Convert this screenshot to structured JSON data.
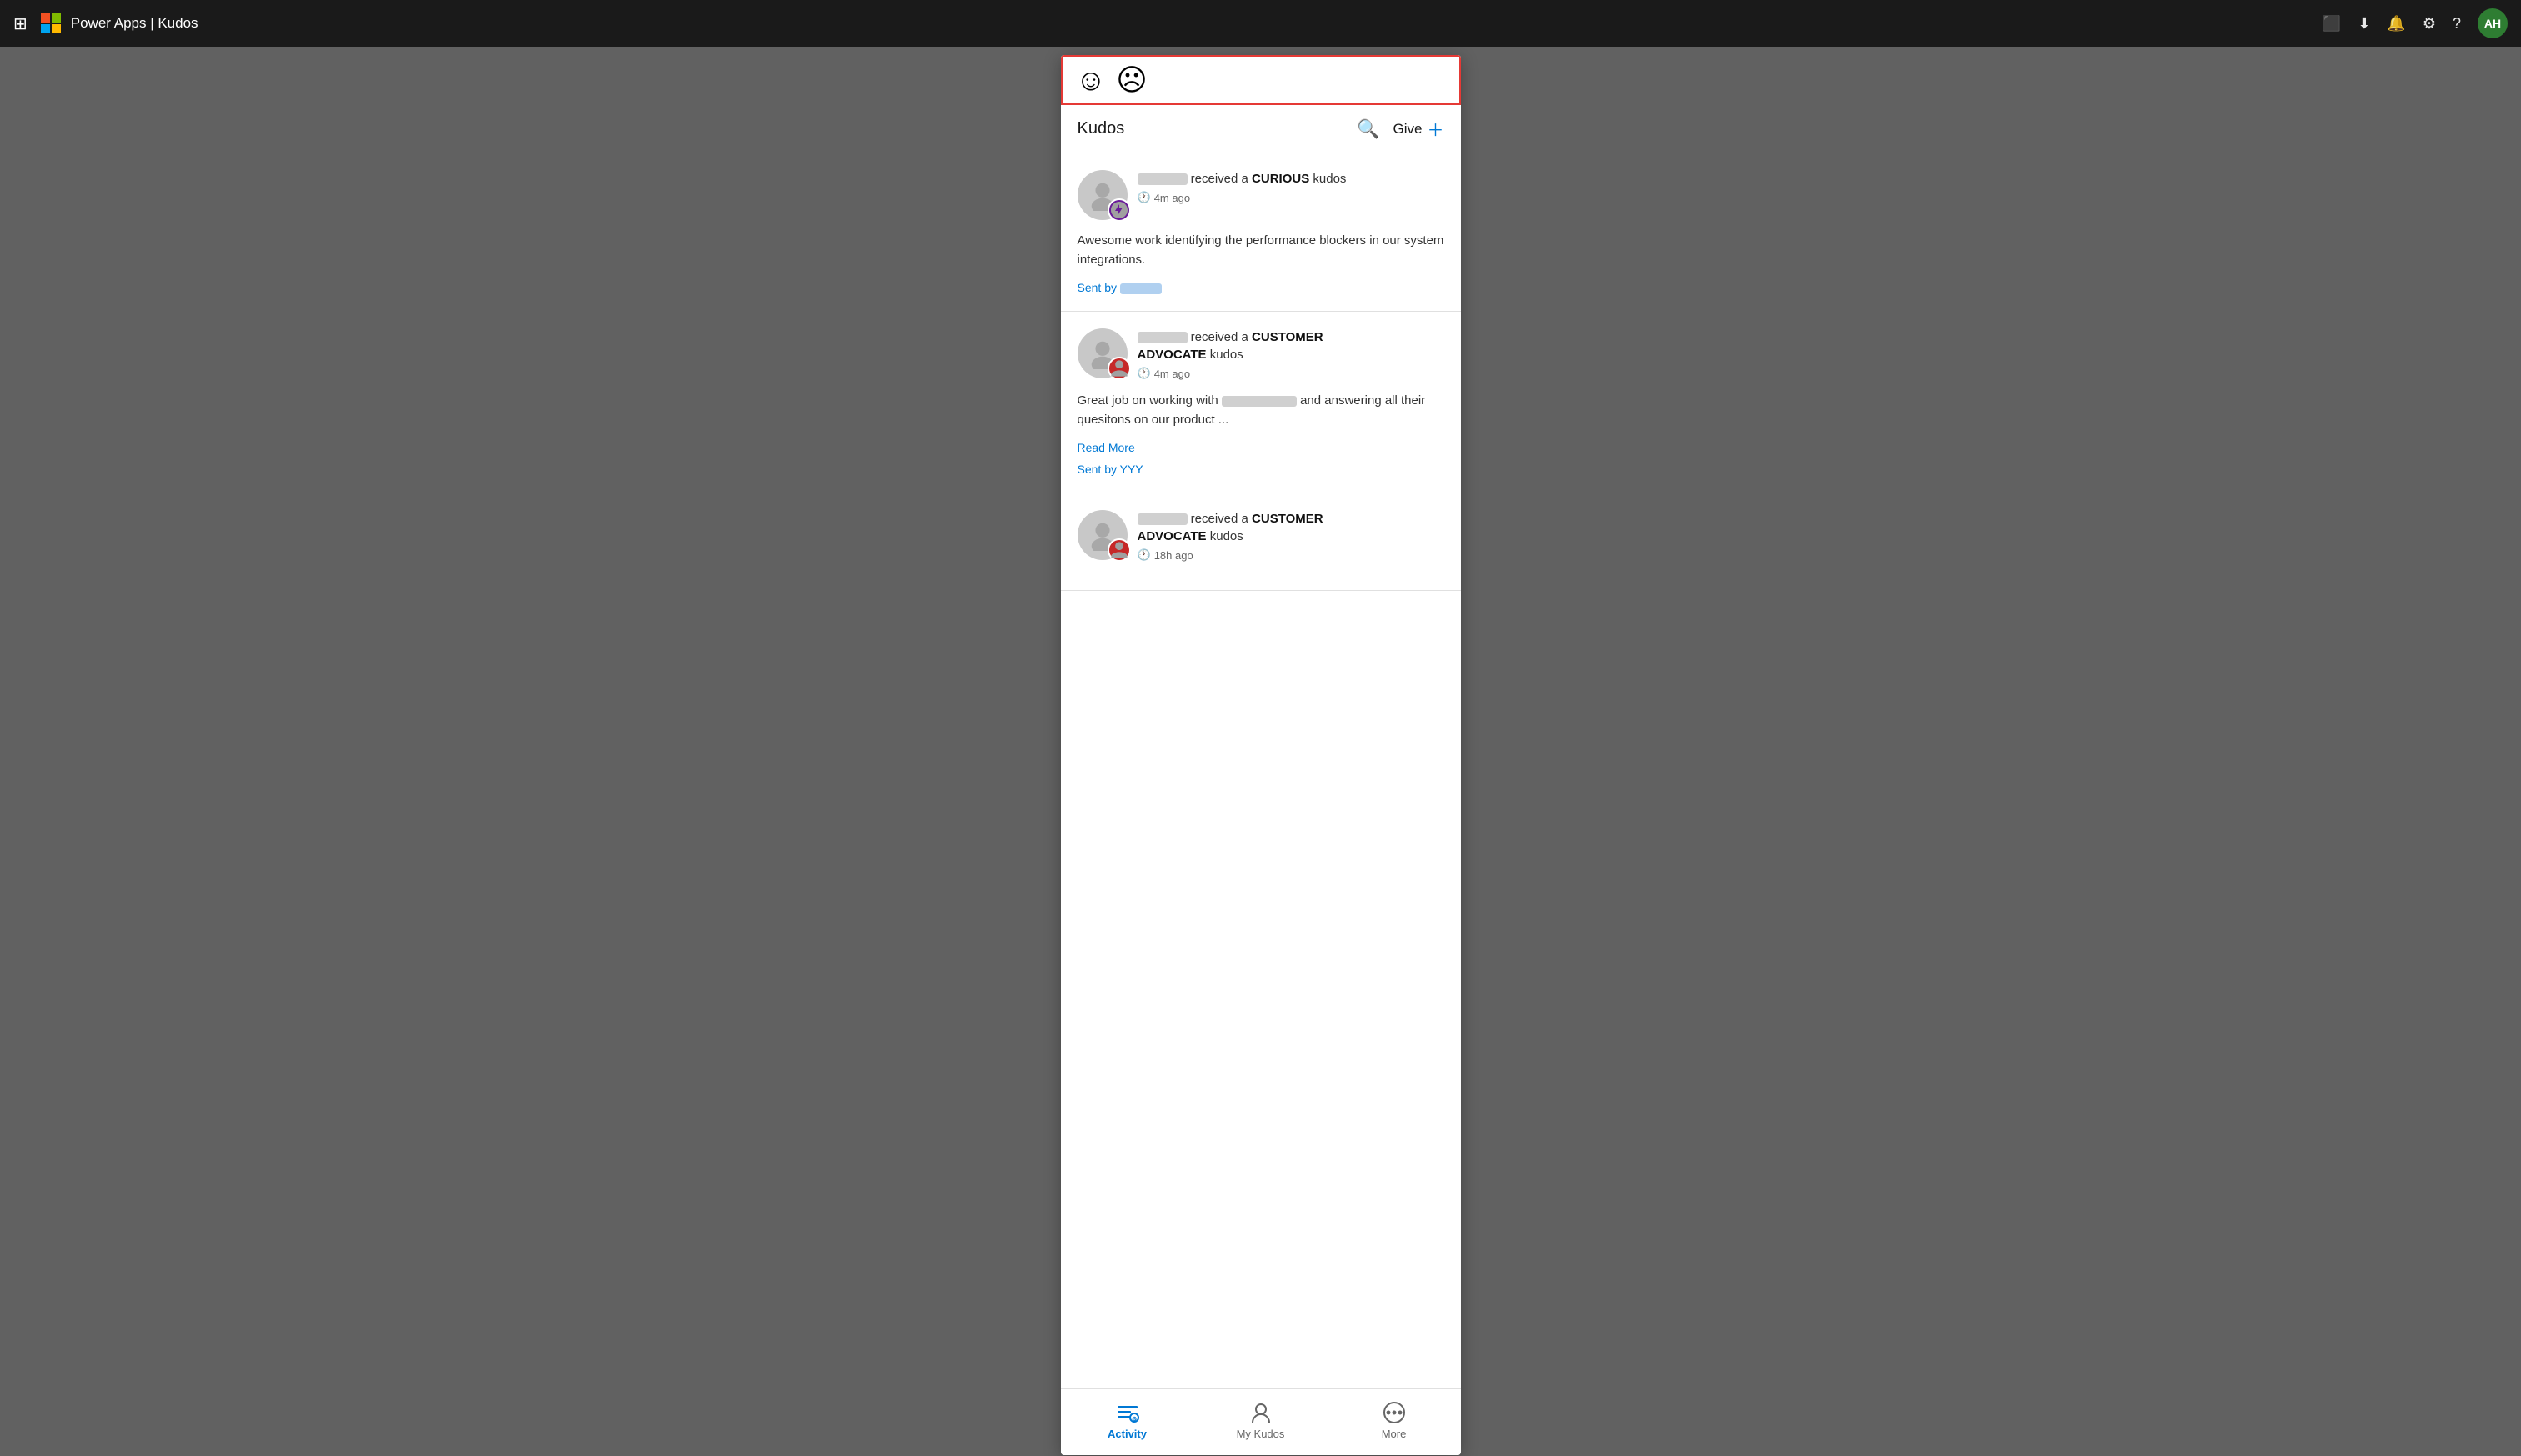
{
  "nav": {
    "waffle_label": "⊞",
    "brand": "Microsoft",
    "app_name": "Power Apps | Kudos",
    "icons": {
      "screen_share": "⬛",
      "download": "⬇",
      "bell": "🔔",
      "settings": "⚙",
      "help": "?"
    },
    "avatar": "AH"
  },
  "panel": {
    "emoji_selector": {
      "happy_emoji": "☺",
      "sad_emoji": "☹"
    },
    "header": {
      "title": "Kudos",
      "give_label": "Give"
    },
    "feed": {
      "cards": [
        {
          "id": 1,
          "recipient_blurred": true,
          "action": "received a",
          "kudos_type": "CURIOUS",
          "kudos_suffix": "kudos",
          "time": "4m ago",
          "badge_type": "curious",
          "body": "Awesome work identifying the performance blockers in our system integrations.",
          "sent_by_label": "Sent by",
          "sender_blurred": true,
          "read_more": false
        },
        {
          "id": 2,
          "recipient_blurred": true,
          "action": "received a",
          "kudos_type": "CUSTOMER\nADVOCATE",
          "kudos_line1": "CUSTOMER",
          "kudos_line2": "ADVOCATE",
          "kudos_suffix": "kudos",
          "time": "4m ago",
          "badge_type": "customer",
          "body": "Great job on working with",
          "body2": "and answering all their quesitons on our product ...",
          "sender_blurred_body": true,
          "sent_by_label": "Sent by",
          "sender": "YYY",
          "read_more": true,
          "read_more_label": "Read More"
        },
        {
          "id": 3,
          "recipient_blurred": true,
          "action": "received a",
          "kudos_line1": "CUSTOMER",
          "kudos_line2": "ADVOCATE",
          "kudos_suffix": "kudos",
          "time": "18h ago",
          "badge_type": "customer",
          "partial": true
        }
      ]
    },
    "bottom_nav": {
      "items": [
        {
          "id": "activity",
          "label": "Activity",
          "active": true
        },
        {
          "id": "mykudos",
          "label": "My Kudos",
          "active": false
        },
        {
          "id": "more",
          "label": "More",
          "active": false
        }
      ]
    }
  }
}
